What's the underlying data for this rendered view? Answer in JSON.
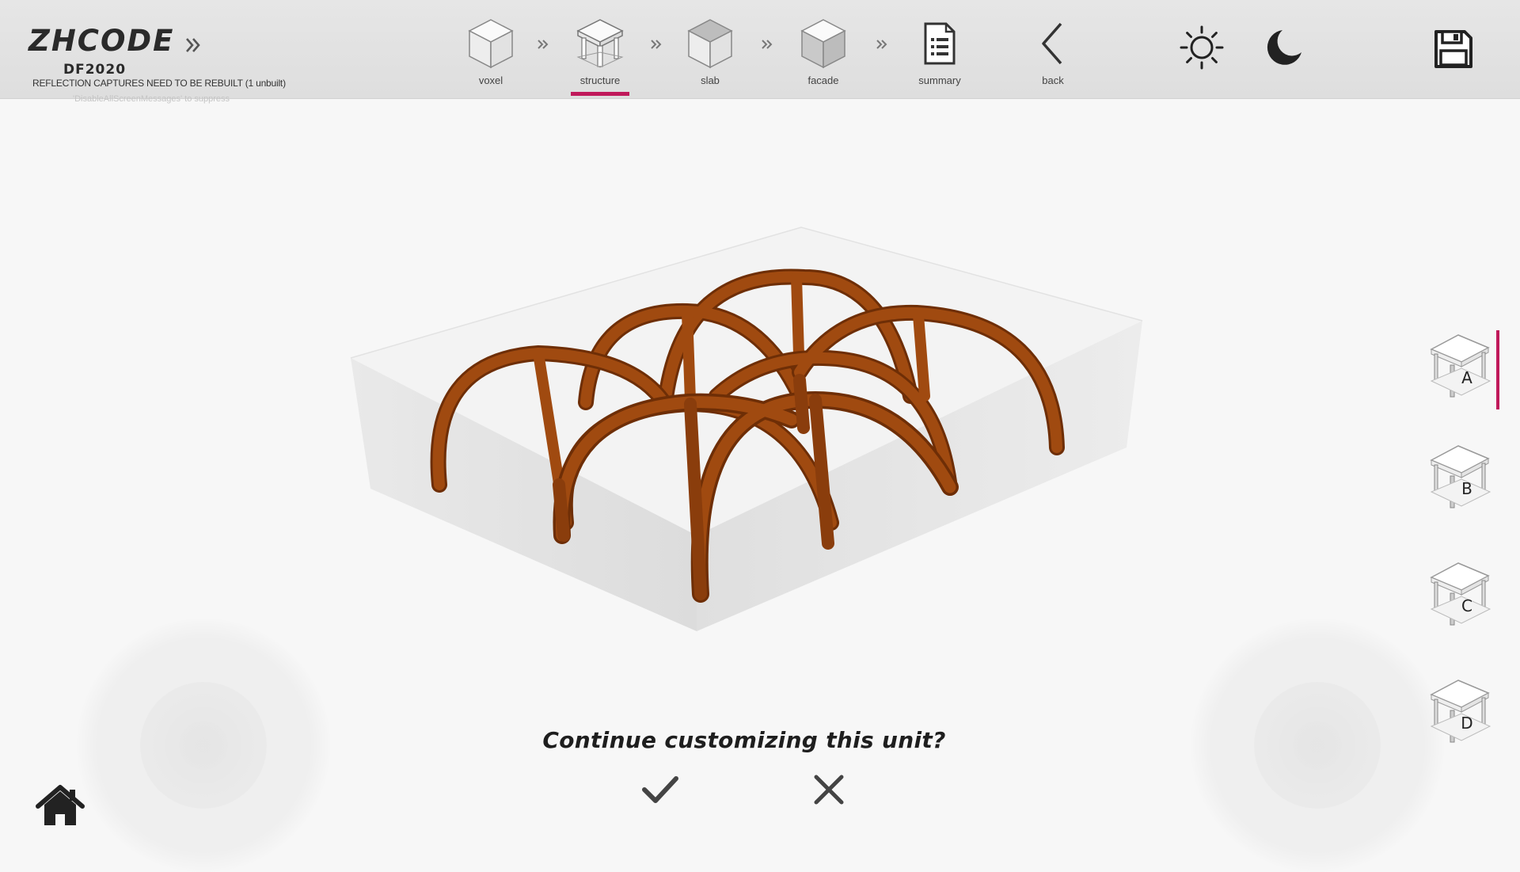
{
  "brand": {
    "name": "ZHCODE",
    "subtitle": "DF2020",
    "warning": "REFLECTION CAPTURES NEED TO BE REBUILT (1 unbuilt)",
    "suppress_hint": "'DisableAllScreenMessages' to suppress"
  },
  "steps": [
    {
      "label": "voxel",
      "icon": "voxel-cube-icon"
    },
    {
      "label": "structure",
      "icon": "structure-cube-icon",
      "active": true
    },
    {
      "label": "slab",
      "icon": "slab-cube-icon"
    },
    {
      "label": "facade",
      "icon": "facade-cube-icon"
    },
    {
      "label": "summary",
      "icon": "document-list-icon"
    },
    {
      "label": "back",
      "icon": "chevron-left-icon"
    }
  ],
  "toolbar_right": {
    "light_mode_icon": "sun-icon",
    "dark_mode_icon": "moon-icon",
    "save_icon": "floppy-disk-icon"
  },
  "options": [
    {
      "letter": "A",
      "selected": true
    },
    {
      "letter": "B"
    },
    {
      "letter": "C"
    },
    {
      "letter": "D"
    }
  ],
  "prompt": {
    "question": "Continue customizing this unit?",
    "confirm_icon": "checkmark-icon",
    "cancel_icon": "x-close-icon"
  },
  "home_icon": "home-icon",
  "colors": {
    "accent": "#c0195a",
    "arch": "#a04a10",
    "arch_dark": "#6e2e06",
    "toolbar": "#e3e3e3"
  }
}
